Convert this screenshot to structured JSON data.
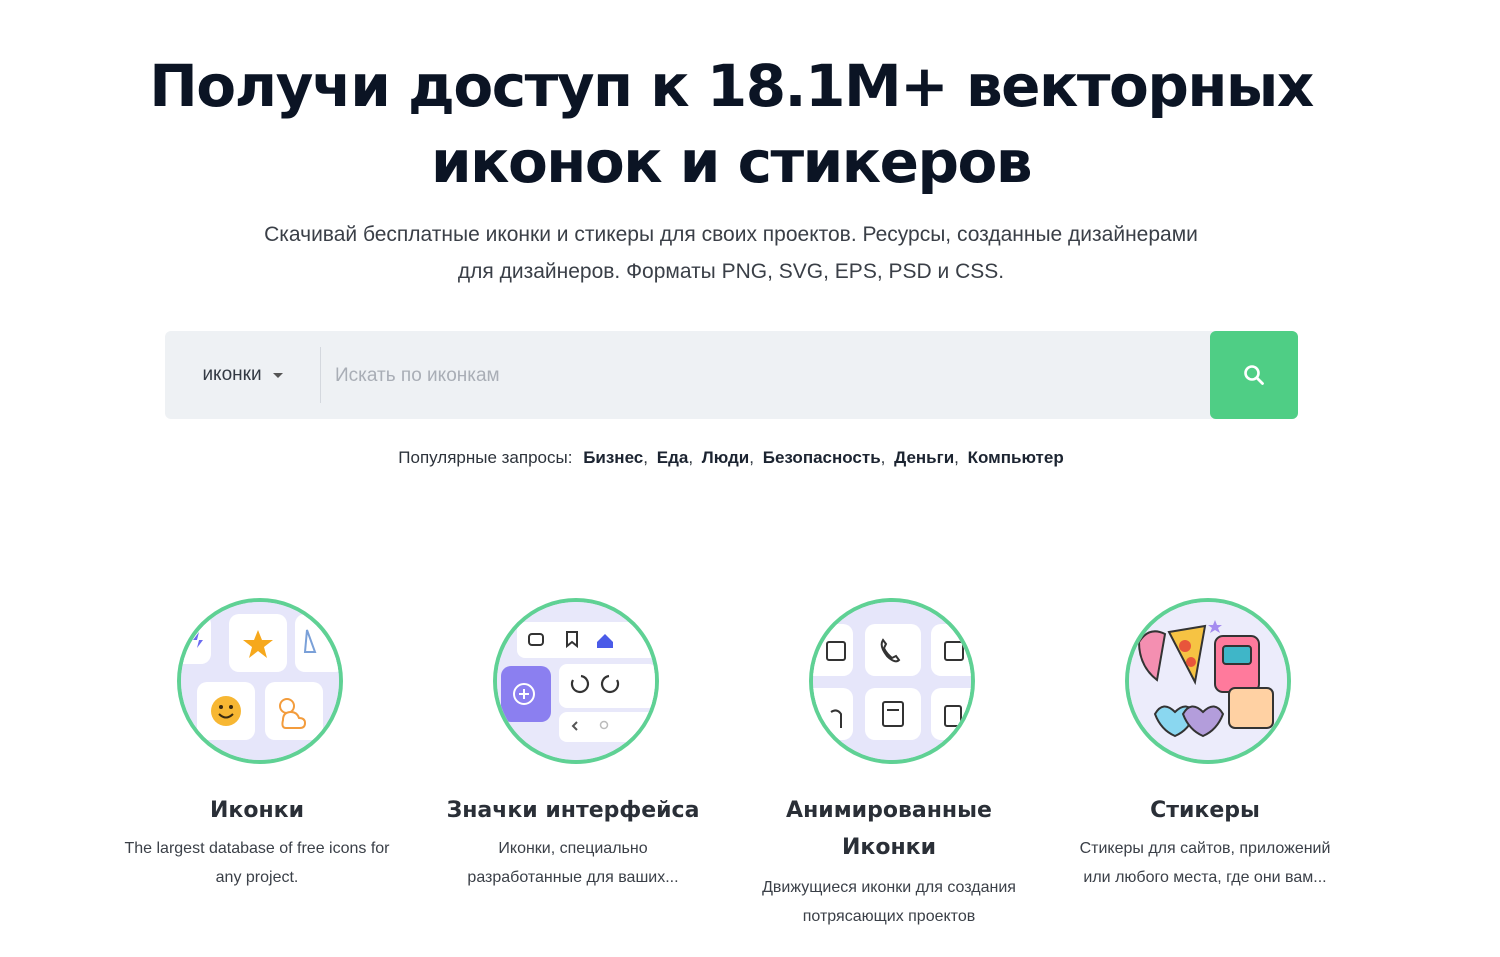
{
  "hero": {
    "title_line1": "Получи доступ к 18.1M+ векторных",
    "title_line2": "иконок и стикеров",
    "subtitle_line1": "Скачивай бесплатные иконки и стикеры для своих проектов. Ресурсы, созданные дизайнерами",
    "subtitle_line2": "для дизайнеров. Форматы PNG, SVG, EPS, PSD и CSS."
  },
  "search": {
    "type_value": "иконки",
    "placeholder": "Искать по иконкам",
    "button_icon": "search-icon",
    "button_color": "#4fce85"
  },
  "popular": {
    "label": "Популярные запросы:",
    "items": [
      "Бизнес",
      "Еда",
      "Люди",
      "Безопасность",
      "Деньги",
      "Компьютер"
    ]
  },
  "cards": [
    {
      "title": "Иконки",
      "desc_line1": "The largest database of free icons for",
      "desc_line2": "any project."
    },
    {
      "title": "Значки интерфейса",
      "desc_line1": "Иконки, специально",
      "desc_line2": "разработанные для ваших..."
    },
    {
      "title_line1": "Анимированные",
      "title_line2": "Иконки",
      "desc_line1": "Движущиеся иконки для создания",
      "desc_line2": "потрясающих проектов"
    },
    {
      "title": "Стикеры",
      "desc_line1": "Стикеры для сайтов, приложений",
      "desc_line2": "или любого места, где они вам..."
    }
  ],
  "colors": {
    "accent_green": "#4fce85",
    "circle_border": "#5fd194",
    "title_dark": "#0b1424"
  }
}
